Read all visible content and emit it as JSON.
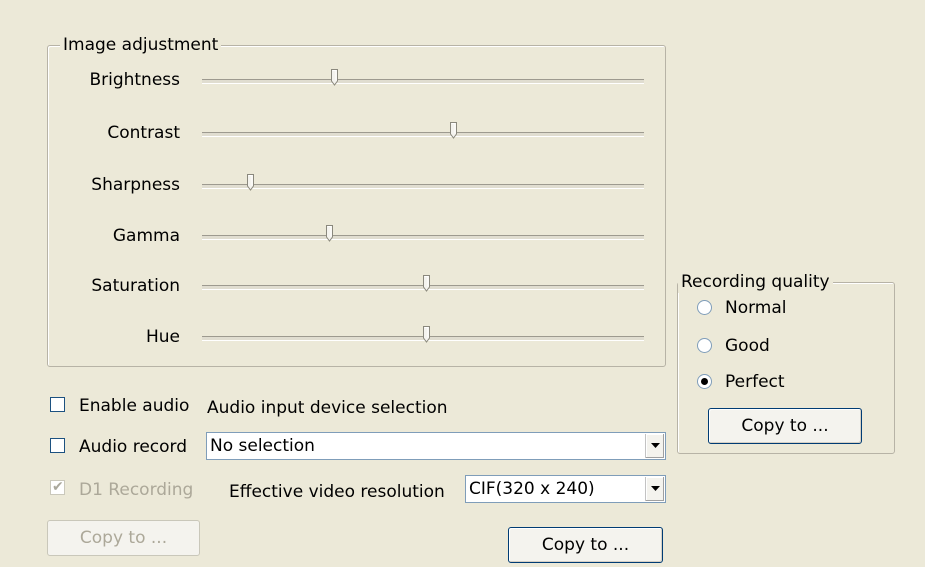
{
  "image_adjustment": {
    "title": "Image adjustment",
    "sliders": [
      {
        "label": "Brightness",
        "value": 0.3
      },
      {
        "label": "Contrast",
        "value": 0.57
      },
      {
        "label": "Sharpness",
        "value": 0.11
      },
      {
        "label": "Gamma",
        "value": 0.29
      },
      {
        "label": "Saturation",
        "value": 0.51
      },
      {
        "label": "Hue",
        "value": 0.51
      }
    ]
  },
  "audio": {
    "enable_audio_label": "Enable audio",
    "enable_audio_checked": false,
    "audio_record_label": "Audio record",
    "audio_record_checked": false,
    "device_selection_label": "Audio input device selection",
    "device_selection_value": "No selection"
  },
  "video": {
    "d1_recording_label": "D1 Recording",
    "d1_recording_checked": true,
    "d1_recording_enabled": false,
    "effective_resolution_label": "Effective video resolution",
    "effective_resolution_value": "CIF(320 x 240)"
  },
  "buttons": {
    "copy_to_left": "Copy to ...",
    "copy_to_center": "Copy to ...",
    "copy_to_quality": "Copy to ..."
  },
  "recording_quality": {
    "title": "Recording quality",
    "options": [
      {
        "label": "Normal",
        "selected": false
      },
      {
        "label": "Good",
        "selected": false
      },
      {
        "label": "Perfect",
        "selected": true
      }
    ]
  }
}
